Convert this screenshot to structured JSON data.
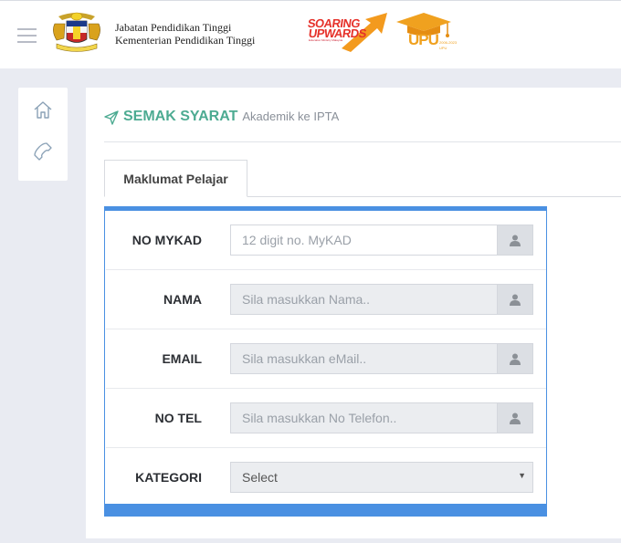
{
  "header": {
    "ministry_line1": "Jabatan Pendidikan Tinggi",
    "ministry_line2": "Kementerian Pendidikan Tinggi",
    "soaring_line1": "SOARING",
    "soaring_line2": "UPWARDS",
    "soaring_tagline": "Education Ministry Malaysia",
    "upu_logo_text": "UPU",
    "upu_years_line1": "2006-2023",
    "upu_years_line2": "UPU"
  },
  "sidebar": {
    "items": [
      {
        "icon": "home-icon"
      },
      {
        "icon": "phone-icon"
      }
    ]
  },
  "page": {
    "title": "SEMAK SYARAT",
    "subtitle": "Akademik ke IPTA",
    "tab_label": "Maklumat Pelajar"
  },
  "form": {
    "fields": [
      {
        "label": "NO MYKAD",
        "placeholder": "12 digit no. MyKAD",
        "value": ""
      },
      {
        "label": "NAMA",
        "placeholder": "Sila masukkan Nama..",
        "value": ""
      },
      {
        "label": "EMAIL",
        "placeholder": "Sila masukkan eMail..",
        "value": ""
      },
      {
        "label": "NO TEL",
        "placeholder": "Sila masukkan No Telefon..",
        "value": ""
      }
    ],
    "kategori": {
      "label": "KATEGORI",
      "selected": "Select"
    }
  },
  "colors": {
    "accent_green": "#4dab92",
    "form_border_blue": "#4a90e2"
  }
}
